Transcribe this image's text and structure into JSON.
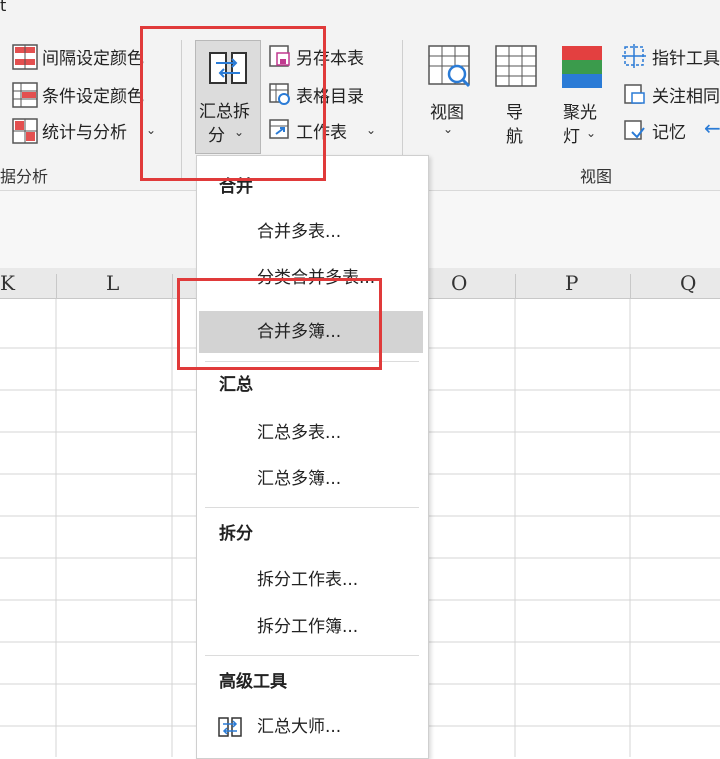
{
  "window": {
    "title_fragment": "t"
  },
  "ribbon": {
    "left_group": {
      "items": [
        {
          "label": "间隔设定颜色",
          "icon": "interval-color-icon"
        },
        {
          "label": "条件设定颜色",
          "icon": "condition-color-icon"
        },
        {
          "label": "统计与分析",
          "icon": "stats-analysis-icon",
          "has_dropdown": true
        }
      ],
      "group_label": "据分析"
    },
    "merge_split_button": {
      "line1": "汇总拆",
      "line2": "分",
      "icon": "merge-split-icon"
    },
    "mid_group": {
      "items": [
        {
          "label": "另存本表",
          "icon": "save-sheet-icon"
        },
        {
          "label": "表格目录",
          "icon": "table-directory-icon"
        },
        {
          "label": "工作表",
          "icon": "worksheet-icon",
          "has_dropdown": true
        }
      ]
    },
    "view_group": {
      "buttons": [
        {
          "line1": "视图",
          "line2": "",
          "icon": "view-icon",
          "has_dropdown": true
        },
        {
          "line1": "导",
          "line2": "航",
          "icon": "navigation-icon"
        },
        {
          "line1": "聚光",
          "line2": "灯",
          "icon": "spotlight-icon",
          "has_dropdown": true
        }
      ],
      "items": [
        {
          "label": "指针工具",
          "icon": "pointer-tool-icon"
        },
        {
          "label": "关注相同",
          "icon": "focus-same-icon"
        },
        {
          "label": "记忆",
          "icon": "memory-icon"
        }
      ],
      "group_label": "视图"
    }
  },
  "columns": [
    "K",
    "L",
    "O",
    "P",
    "Q"
  ],
  "menu": {
    "sections": [
      {
        "header": "合并",
        "items": [
          "合并多表...",
          "分类合并多表...",
          "合并多簿..."
        ]
      },
      {
        "header": "汇总",
        "items": [
          "汇总多表...",
          "汇总多簿..."
        ]
      },
      {
        "header": "拆分",
        "items": [
          "拆分工作表...",
          "拆分工作簿..."
        ]
      },
      {
        "header": "高级工具",
        "items": [
          "汇总大师..."
        ]
      }
    ],
    "highlighted": "合并多簿..."
  },
  "colors": {
    "highlight": "#e03a3a",
    "accent_blue": "#2a7bd6"
  }
}
